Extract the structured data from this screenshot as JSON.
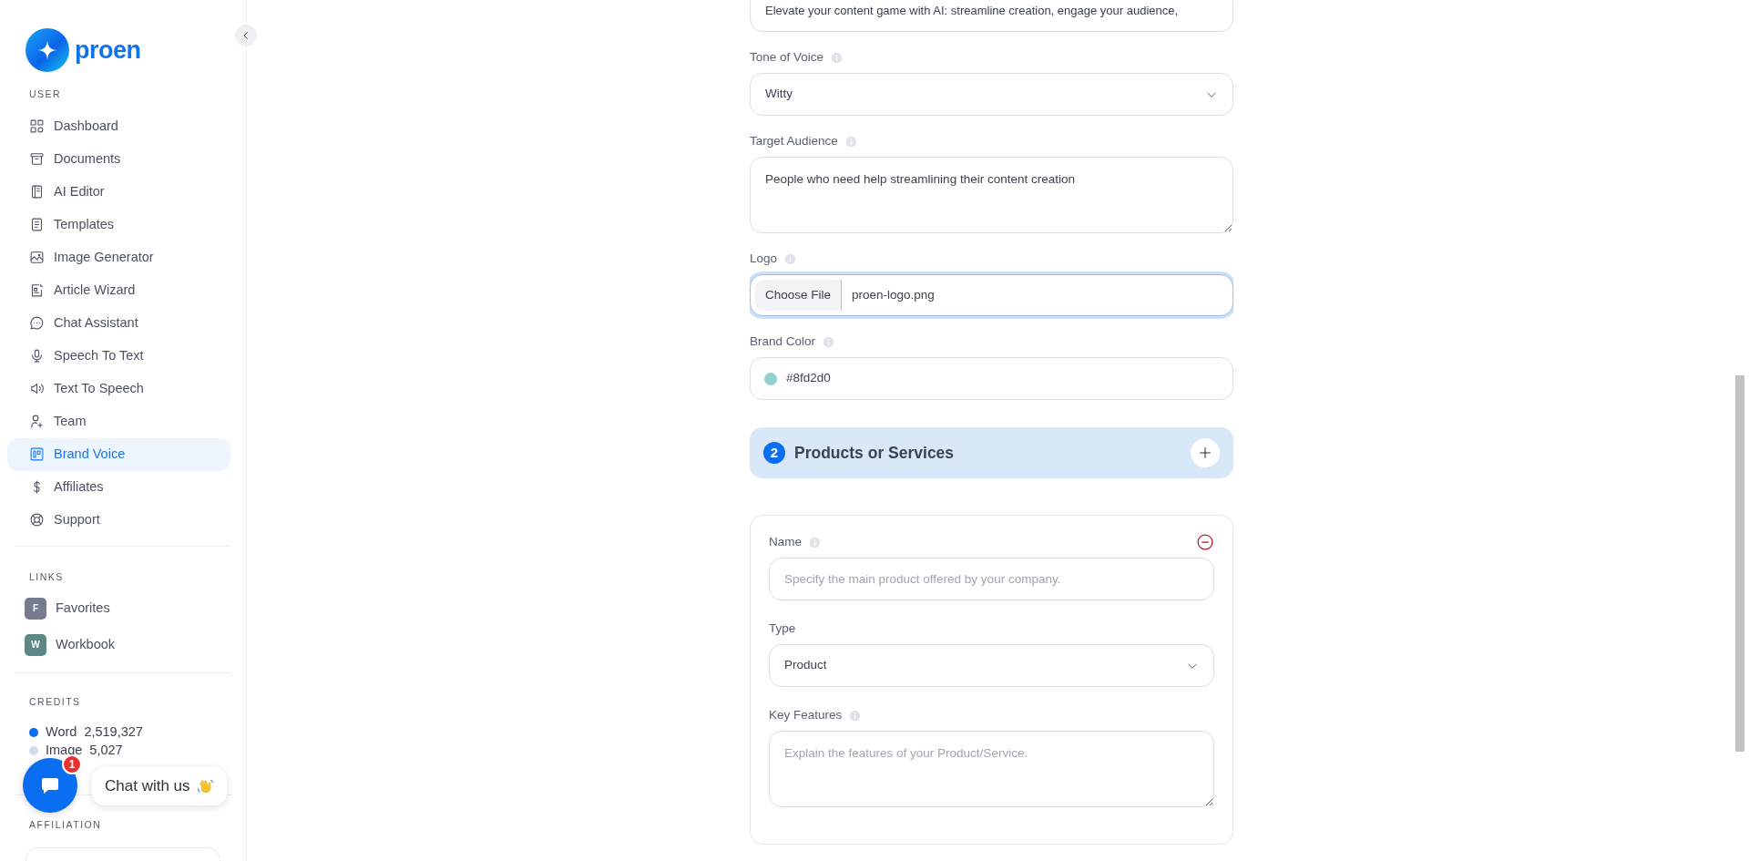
{
  "sidebar": {
    "brand": "proen",
    "user_heading": "USER",
    "nav_items": [
      {
        "label": "Dashboard",
        "selected": false
      },
      {
        "label": "Documents",
        "selected": false
      },
      {
        "label": "AI Editor",
        "selected": false
      },
      {
        "label": "Templates",
        "selected": false
      },
      {
        "label": "Image Generator",
        "selected": false
      },
      {
        "label": "Article Wizard",
        "selected": false
      },
      {
        "label": "Chat Assistant",
        "selected": false
      },
      {
        "label": "Speech To Text",
        "selected": false
      },
      {
        "label": "Text To Speech",
        "selected": false
      },
      {
        "label": "Team",
        "selected": false
      },
      {
        "label": "Brand Voice",
        "selected": true
      },
      {
        "label": "Affiliates",
        "selected": false
      },
      {
        "label": "Support",
        "selected": false
      }
    ],
    "links_heading": "LINKS",
    "links": [
      {
        "initial": "F",
        "label": "Favorites",
        "color": "#767b8f"
      },
      {
        "initial": "W",
        "label": "Workbook",
        "color": "#5c8784"
      }
    ],
    "credits_heading": "CREDITS",
    "credits": [
      {
        "label": "Word",
        "amount": "2,519,327",
        "color": "#0a6ef0"
      },
      {
        "label": "Image",
        "amount": "5,027",
        "color": "#d3dcea"
      }
    ],
    "affiliation_heading": "AFFILIATION"
  },
  "form": {
    "fields": [
      {
        "kind": "text",
        "value": "Elevate your content game with AI: streamline creation, engage your audience,"
      },
      {
        "kind": "select",
        "label": "Tone of Voice",
        "info": true,
        "value": "Witty"
      },
      {
        "kind": "textarea",
        "label": "Target Audience",
        "info": true,
        "value": "People who need help streamlining their content creation"
      },
      {
        "kind": "file",
        "label": "Logo",
        "info": true,
        "button": "Choose File",
        "value": "proen-logo.png",
        "focused": true
      },
      {
        "kind": "color",
        "label": "Brand Color",
        "info": true,
        "value": "#8fd2d0",
        "color": "#8fd2d0"
      }
    ],
    "section": {
      "number": "2",
      "title": "Products or Services"
    },
    "product_fields": [
      {
        "kind": "text",
        "label": "Name",
        "info": true,
        "placeholder": "Specify the main product offered by your company."
      },
      {
        "kind": "select",
        "label": "Type",
        "info": false,
        "value": "Product"
      },
      {
        "kind": "textarea",
        "label": "Key Features",
        "info": true,
        "placeholder": "Explain the features of your Product/Service."
      }
    ]
  },
  "chat": {
    "badge": "1",
    "label": "Chat with us"
  }
}
